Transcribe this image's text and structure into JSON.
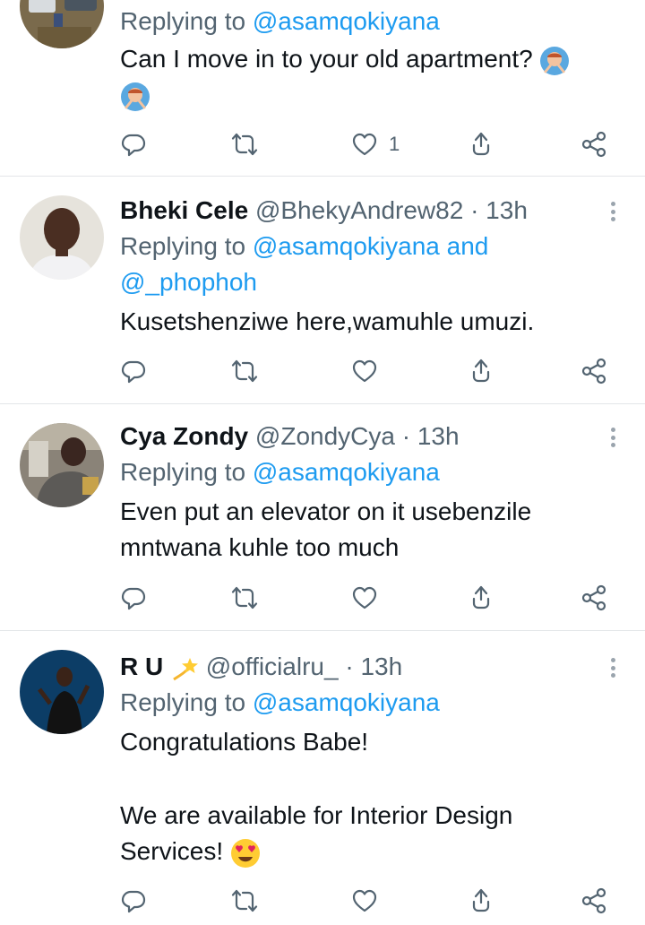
{
  "colors": {
    "accent": "#1d9bf0",
    "muted_text": "#536471",
    "primary_text": "#0f1419",
    "divider": "#e3e6e9"
  },
  "tweets": [
    {
      "reply_label": "Replying to",
      "mention": "@asamqokiyana",
      "body": "Can I move in to your old apartment?",
      "emojis": [
        "man-gesturing-no-emoji",
        "man-gesturing-no-emoji"
      ],
      "likes": "1"
    },
    {
      "display_name": "Bheki Cele",
      "handle": "@BhekyAndrew82",
      "separator": "·",
      "time": "13h",
      "reply_label": "Replying to",
      "mention": "@asamqokiyana",
      "mention_joiner": "and",
      "mention2": "@_phophoh",
      "body": "Kusetshenziwe here,wamuhle umuzi."
    },
    {
      "display_name": "Cya Zondy",
      "handle": "@ZondyCya",
      "separator": "·",
      "time": "13h",
      "reply_label": "Replying to",
      "mention": "@asamqokiyana",
      "body_line1": "Even put an elevator on it usebenzile",
      "body_line2": "mntwana kuhle too much"
    },
    {
      "display_name": "R U",
      "name_emoji": "shooting-star-emoji",
      "handle": "@officialru_",
      "separator": "·",
      "time": "13h",
      "reply_label": "Replying to",
      "mention": "@asamqokiyana",
      "body_line1": "Congratulations Babe!",
      "body_line2": "We are available for Interior Design",
      "body_line3": "Services!",
      "body_emoji": "heart-eyes-emoji"
    }
  ],
  "action_icons": [
    "reply-icon",
    "retweet-icon",
    "like-icon",
    "share-up-icon",
    "share-icon"
  ]
}
